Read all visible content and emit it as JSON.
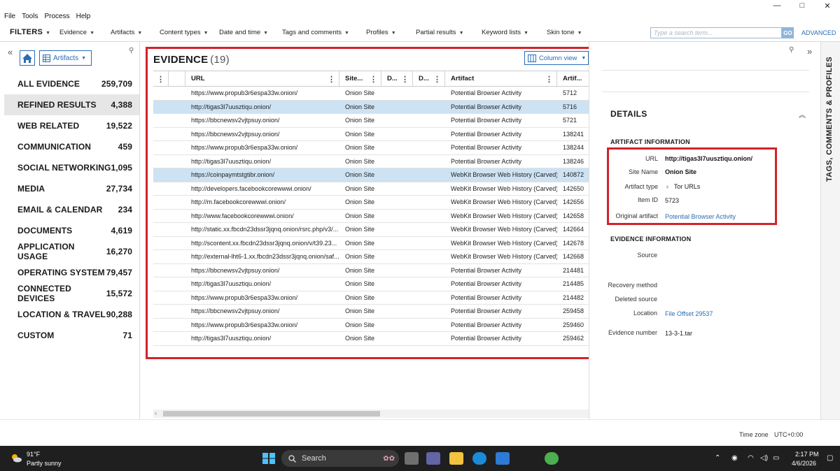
{
  "menu": [
    "File",
    "Tools",
    "Process",
    "Help"
  ],
  "window_controls": [
    "—",
    "□",
    "✕"
  ],
  "filterbar": {
    "title": "FILTERS",
    "items": [
      "Evidence",
      "Artifacts",
      "Content types",
      "Date and time",
      "Tags and comments",
      "Profiles",
      "Partial results",
      "Keyword lists",
      "Skin tone"
    ],
    "search_placeholder": "Type a search term...",
    "go_label": "GO",
    "advanced_label": "ADVANCED"
  },
  "sidebar": {
    "view_label": "Artifacts",
    "categories": [
      {
        "label": "ALL EVIDENCE",
        "count": "259,709"
      },
      {
        "label": "REFINED RESULTS",
        "count": "4,388"
      },
      {
        "label": "WEB RELATED",
        "count": "19,522"
      },
      {
        "label": "COMMUNICATION",
        "count": "459"
      },
      {
        "label": "SOCIAL NETWORKING",
        "count": "1,095"
      },
      {
        "label": "MEDIA",
        "count": "27,734"
      },
      {
        "label": "EMAIL & CALENDAR",
        "count": "234"
      },
      {
        "label": "DOCUMENTS",
        "count": "4,619"
      },
      {
        "label": "APPLICATION USAGE",
        "count": "16,270"
      },
      {
        "label": "OPERATING SYSTEM",
        "count": "79,457"
      },
      {
        "label": "CONNECTED DEVICES",
        "count": "15,572"
      },
      {
        "label": "LOCATION & TRAVEL",
        "count": "90,288"
      },
      {
        "label": "CUSTOM",
        "count": "71"
      }
    ]
  },
  "evidence": {
    "title": "EVIDENCE",
    "count": "(19)",
    "column_view_label": "Column view",
    "columns": [
      "URL",
      "Site...",
      "D...",
      "D...",
      "Artifact",
      "Artif..."
    ],
    "rows": [
      {
        "url": "https://www.propub3r6espa33w.onion/",
        "site": "Onion Site",
        "artifact": "Potential Browser Activity",
        "id": "5712",
        "selected": false
      },
      {
        "url": "http://tigas3l7uusztiqu.onion/",
        "site": "Onion Site",
        "artifact": "Potential Browser Activity",
        "id": "5716",
        "selected": true
      },
      {
        "url": "https://bbcnewsv2vjtpsuy.onion/",
        "site": "Onion Site",
        "artifact": "Potential Browser Activity",
        "id": "5721",
        "selected": false
      },
      {
        "url": "https://bbcnewsv2vjtpsuy.onion/",
        "site": "Onion Site",
        "artifact": "Potential Browser Activity",
        "id": "138241",
        "selected": false
      },
      {
        "url": "https://www.propub3r6espa33w.onion/",
        "site": "Onion Site",
        "artifact": "Potential Browser Activity",
        "id": "138244",
        "selected": false
      },
      {
        "url": "http://tigas3l7uusztiqu.onion/",
        "site": "Onion Site",
        "artifact": "Potential Browser Activity",
        "id": "138246",
        "selected": false
      },
      {
        "url": "https://coinpaymtstgtibr.onion/",
        "site": "Onion Site",
        "artifact": "WebKit Browser Web History (Carved)",
        "id": "140872",
        "selected": true
      },
      {
        "url": "http://developers.facebookcorewwwi.onion/",
        "site": "Onion Site",
        "artifact": "WebKit Browser Web History (Carved)",
        "id": "142650",
        "selected": false
      },
      {
        "url": "http://m.facebookcorewwwi.onion/",
        "site": "Onion Site",
        "artifact": "WebKit Browser Web History (Carved)",
        "id": "142656",
        "selected": false
      },
      {
        "url": "http://www.facebookcorewwwi.onion/",
        "site": "Onion Site",
        "artifact": "WebKit Browser Web History (Carved)",
        "id": "142658",
        "selected": false
      },
      {
        "url": "http://static.xx.fbcdn23dssr3jqnq.onion/rsrc.php/v3/...",
        "site": "Onion Site",
        "artifact": "WebKit Browser Web History (Carved)",
        "id": "142664",
        "selected": false
      },
      {
        "url": "http://scontent.xx.fbcdn23dssr3jqnq.onion/v/t39.23...",
        "site": "Onion Site",
        "artifact": "WebKit Browser Web History (Carved)",
        "id": "142678",
        "selected": false
      },
      {
        "url": "http://external-lht6-1.xx.fbcdn23dssr3jqnq.onion/saf...",
        "site": "Onion Site",
        "artifact": "WebKit Browser Web History (Carved)",
        "id": "142668",
        "selected": false
      },
      {
        "url": "https://bbcnewsv2vjtpsuy.onion/",
        "site": "Onion Site",
        "artifact": "Potential Browser Activity",
        "id": "214481",
        "selected": false
      },
      {
        "url": "http://tigas3l7uusztiqu.onion/",
        "site": "Onion Site",
        "artifact": "Potential Browser Activity",
        "id": "214485",
        "selected": false
      },
      {
        "url": "https://www.propub3r6espa33w.onion/",
        "site": "Onion Site",
        "artifact": "Potential Browser Activity",
        "id": "214482",
        "selected": false
      },
      {
        "url": "https://bbcnewsv2vjtpsuy.onion/",
        "site": "Onion Site",
        "artifact": "Potential Browser Activity",
        "id": "259458",
        "selected": false
      },
      {
        "url": "https://www.propub3r6espa33w.onion/",
        "site": "Onion Site",
        "artifact": "Potential Browser Activity",
        "id": "259460",
        "selected": false
      },
      {
        "url": "http://tigas3l7uusztiqu.onion/",
        "site": "Onion Site",
        "artifact": "Potential Browser Activity",
        "id": "259462",
        "selected": false
      }
    ]
  },
  "details": {
    "title": "DETAILS",
    "artifact_section": "ARTIFACT INFORMATION",
    "url_label": "URL",
    "url_value": "http://tigas3l7uusztiqu.onion/",
    "site_label": "Site Name",
    "site_value": "Onion Site",
    "type_label": "Artifact type",
    "type_value": "Tor URLs",
    "id_label": "Item ID",
    "id_value": "5723",
    "orig_label": "Original artifact",
    "orig_value": "Potential Browser Activity",
    "evidence_section": "EVIDENCE INFORMATION",
    "source_label": "Source",
    "recovery_label": "Recovery method",
    "deleted_label": "Deleted source",
    "location_label": "Location",
    "location_value": "File Offset 29537",
    "evnum_label": "Evidence number",
    "evnum_value": "13-3-1.tar"
  },
  "tags_panel_label": "TAGS, COMMENTS & PROFILES",
  "status": {
    "tz_label": "Time zone",
    "tz_value": "UTC+0:00"
  },
  "taskbar": {
    "temp": "91°F",
    "weather": "Partly sunny",
    "search_label": "Search",
    "time": "2:17 PM",
    "date": "4/6/2026"
  },
  "colors": {
    "accent": "#2a6db5",
    "highlight_box": "#d2232a",
    "selected_row": "#cde2f2"
  }
}
